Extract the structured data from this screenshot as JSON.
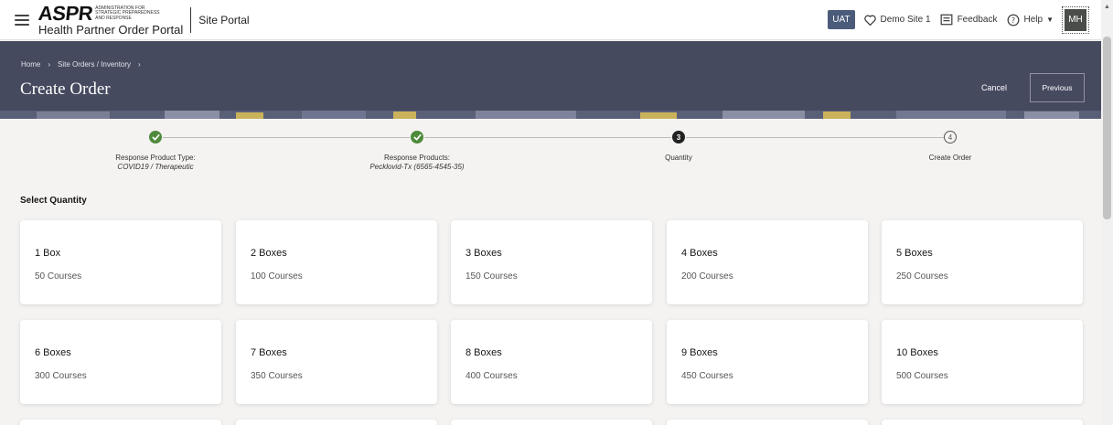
{
  "topbar": {
    "logo_mark": "ASPR",
    "logo_small": "Administration for Strategic Preparedness and Response",
    "logo_sub": "Health Partner Order Portal",
    "portal_name": "Site Portal",
    "env_badge": "UAT",
    "site": "Demo Site 1",
    "feedback": "Feedback",
    "help": "Help",
    "avatar": "MH",
    "icons": [
      "menu-icon",
      "heart-icon",
      "feedback-icon",
      "help-icon",
      "chevron-down-icon"
    ]
  },
  "header": {
    "breadcrumb": [
      "Home",
      "Site Orders / Inventory"
    ],
    "title": "Create Order",
    "cancel": "Cancel",
    "previous": "Previous",
    "color": "#464a5f"
  },
  "stepper": {
    "steps": [
      {
        "label": "Response Product Type:",
        "sub": "COVID19 / Therapeutic",
        "state": "done"
      },
      {
        "label": "Response Products:",
        "sub": "Pecklovid-Tx (6565-4545-35)",
        "state": "done"
      },
      {
        "label": "Quantity",
        "sub": "",
        "state": "current",
        "number": "3"
      },
      {
        "label": "Create Order",
        "sub": "",
        "state": "pending",
        "number": "4"
      }
    ],
    "done_color": "#4f8a3c"
  },
  "section_title": "Select Quantity",
  "options": [
    {
      "qty": "1 Box",
      "courses": "50 Courses"
    },
    {
      "qty": "2 Boxes",
      "courses": "100 Courses"
    },
    {
      "qty": "3 Boxes",
      "courses": "150 Courses"
    },
    {
      "qty": "4 Boxes",
      "courses": "200 Courses"
    },
    {
      "qty": "5 Boxes",
      "courses": "250 Courses"
    },
    {
      "qty": "6 Boxes",
      "courses": "300 Courses"
    },
    {
      "qty": "7 Boxes",
      "courses": "350 Courses"
    },
    {
      "qty": "8 Boxes",
      "courses": "400 Courses"
    },
    {
      "qty": "9 Boxes",
      "courses": "450 Courses"
    },
    {
      "qty": "10 Boxes",
      "courses": "500 Courses"
    }
  ]
}
